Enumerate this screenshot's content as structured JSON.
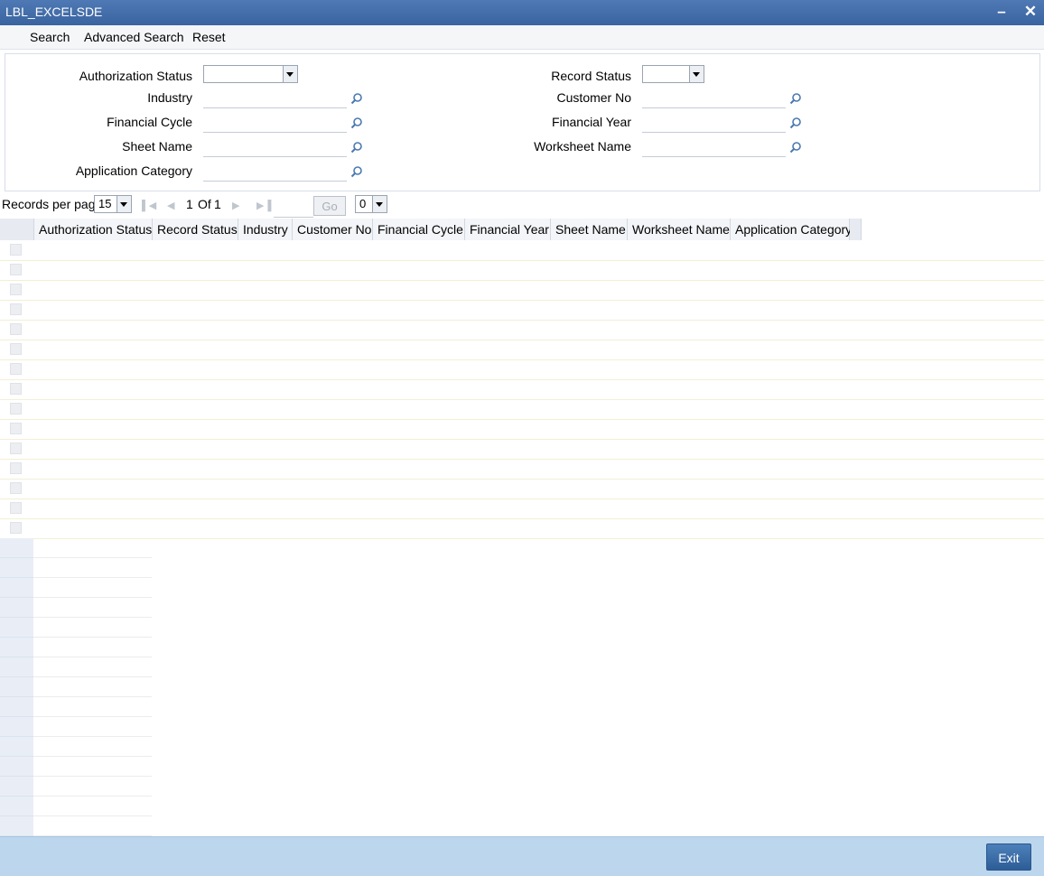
{
  "window": {
    "title": "LBL_EXCELSDE",
    "minimize_icon": "minimize-icon",
    "close_icon": "close-icon"
  },
  "toolbar": {
    "search": "Search",
    "advanced_search": "Advanced Search",
    "reset": "Reset"
  },
  "form": {
    "authorization_status": "Authorization Status",
    "industry": "Industry",
    "financial_cycle": "Financial Cycle",
    "sheet_name": "Sheet Name",
    "application_category": "Application Category",
    "record_status": "Record Status",
    "customer_no": "Customer No",
    "financial_year": "Financial Year",
    "worksheet_name": "Worksheet Name",
    "authorization_status_value": "",
    "record_status_value": ""
  },
  "pager": {
    "records_per_page_label": "Records per page",
    "records_per_page_value": "15",
    "page_current": "1",
    "page_of": "Of",
    "page_total": "1",
    "go_label": "Go",
    "jump_value": "0"
  },
  "grid": {
    "columns": [
      "Authorization Status",
      "Record Status",
      "Industry",
      "Customer No",
      "Financial Cycle",
      "Financial Year",
      "Sheet Name",
      "Worksheet Name",
      "Application Category"
    ]
  },
  "footer": {
    "exit": "Exit"
  }
}
